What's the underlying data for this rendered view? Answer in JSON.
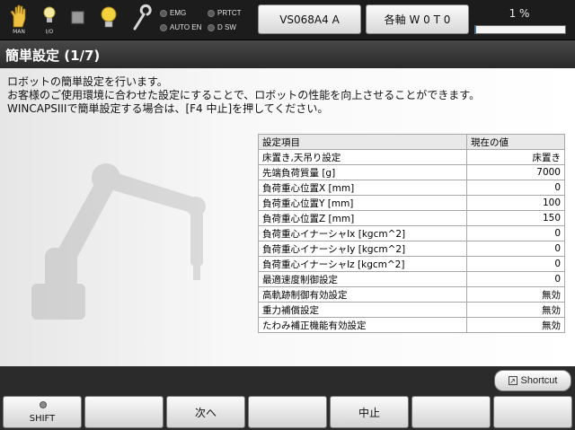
{
  "status_bar": {
    "mode_icons": [
      {
        "name": "hand-icon",
        "label": "MAN"
      },
      {
        "name": "io-icon",
        "label": "I/O"
      }
    ],
    "lamps": [
      {
        "label": "EMG"
      },
      {
        "label": "PRTCT"
      },
      {
        "label": "AUTO EN"
      },
      {
        "label": "D SW"
      }
    ],
    "robot_button": "VS068A4 A",
    "coord_button": "各軸  W 0 T 0",
    "speed_text": "1 %",
    "speed_fraction": 0.01
  },
  "title": "簡単設定 (1/7)",
  "description": [
    "ロボットの簡単設定を行います。",
    "お客様のご使用環境に合わせた設定にすることで、ロボットの性能を向上させることができます。",
    "WINCAPSIIIで簡単設定する場合は、[F4 中止]を押してください。"
  ],
  "table": {
    "headers": [
      "設定項目",
      "現在の値"
    ],
    "rows": [
      {
        "item": "床置き,天吊り設定",
        "value": "床置き"
      },
      {
        "item": "先端負荷質量 [g]",
        "value": "7000"
      },
      {
        "item": "負荷重心位置X [mm]",
        "value": "0"
      },
      {
        "item": "負荷重心位置Y [mm]",
        "value": "100"
      },
      {
        "item": "負荷重心位置Z [mm]",
        "value": "150"
      },
      {
        "item": "負荷重心イナーシャIx [kgcm^2]",
        "value": "0"
      },
      {
        "item": "負荷重心イナーシャIy [kgcm^2]",
        "value": "0"
      },
      {
        "item": "負荷重心イナーシャIz [kgcm^2]",
        "value": "0"
      },
      {
        "item": "最適速度制御設定",
        "value": "0"
      },
      {
        "item": "高軌跡制御有効設定",
        "value": "無効"
      },
      {
        "item": "重力補償設定",
        "value": "無効"
      },
      {
        "item": "たわみ補正機能有効設定",
        "value": "無効"
      }
    ]
  },
  "shortcut_label": "Shortcut",
  "function_keys": [
    "SHIFT",
    "",
    "次へ",
    "",
    "中止",
    "",
    ""
  ],
  "colors": {
    "speed_fill": "#2a7fd0",
    "title_bar": "#3a3a3a"
  }
}
